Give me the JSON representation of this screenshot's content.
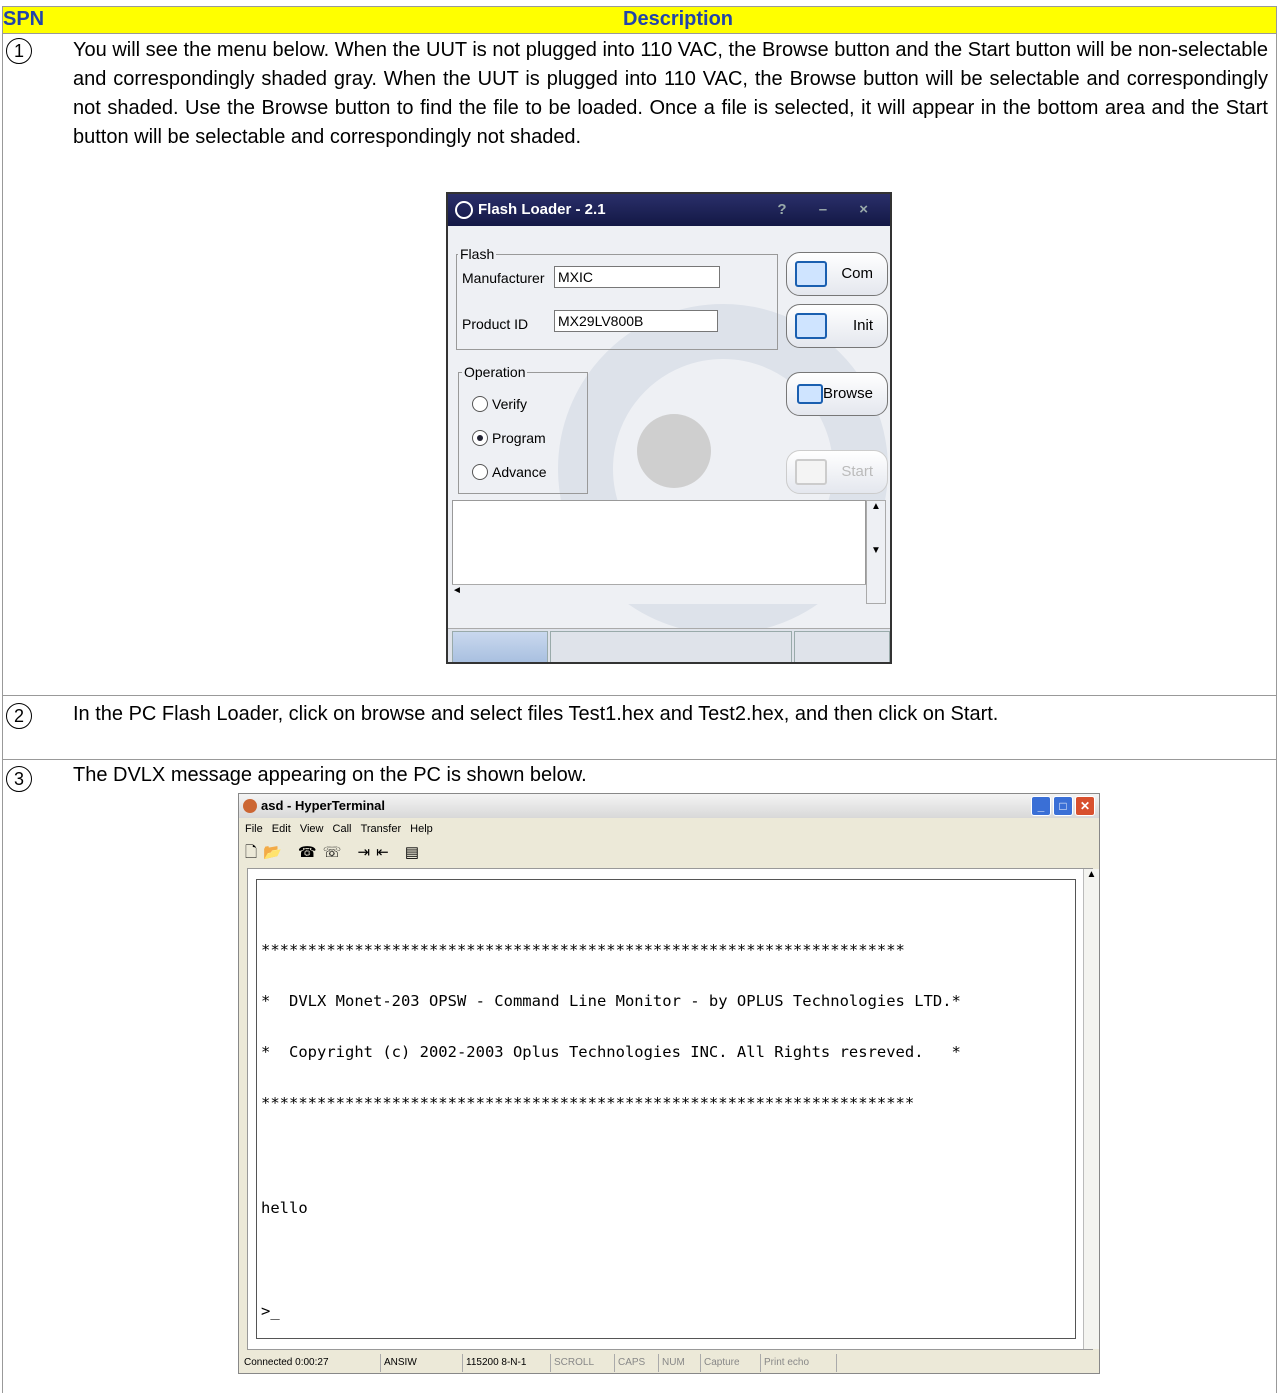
{
  "header": {
    "spn": "SPN",
    "description": "Description"
  },
  "steps": [
    {
      "num": "1",
      "text": "You will see the menu below. When the UUT is not plugged into 110 VAC, the Browse button and the Start button will be non-selectable and correspondingly shaded gray. When the UUT is plugged into 110 VAC, the Browse button will be selectable and correspondingly not shaded. Use the Browse button to find the file to be loaded. Once a file is selected, it will appear in the bottom area and the Start button will be selectable and correspondingly not shaded."
    },
    {
      "num": "2",
      "text": "In the PC Flash Loader, click on browse and select files Test1.hex and Test2.hex, and then click on Start."
    },
    {
      "num": "3",
      "text": "The DVLX message appearing on the PC is shown below."
    }
  ],
  "flash_loader": {
    "title": "Flash Loader - 2.1",
    "title_controls": "? – ×",
    "flash_group": "Flash",
    "manufacturer_label": "Manufacturer",
    "manufacturer_value": "MXIC",
    "product_label": "Product ID",
    "product_value": "MX29LV800B",
    "operation_group": "Operation",
    "options": [
      "Verify",
      "Program",
      "Advance"
    ],
    "selected_option": "Program",
    "com_label": "Com",
    "init_label": "Init",
    "browse_label": "Browse",
    "start_label": "Start"
  },
  "hyperterminal": {
    "title": "asd - HyperTerminal",
    "menu": [
      "File",
      "Edit",
      "View",
      "Call",
      "Transfer",
      "Help"
    ],
    "terminal_lines": [
      "*********************************************************************",
      "*  DVLX Monet-203 OPSW - Command Line Monitor - by OPLUS Technologies LTD.*",
      "*  Copyright (c) 2002-2003 Oplus Technologies INC. All Rights resreved.   *",
      "**********************************************************************",
      "",
      "hello",
      "",
      ">_"
    ],
    "status": [
      "Connected 0:00:27",
      "ANSIW",
      "115200 8-N-1",
      "SCROLL",
      "CAPS",
      "NUM",
      "Capture",
      "Print echo"
    ]
  }
}
